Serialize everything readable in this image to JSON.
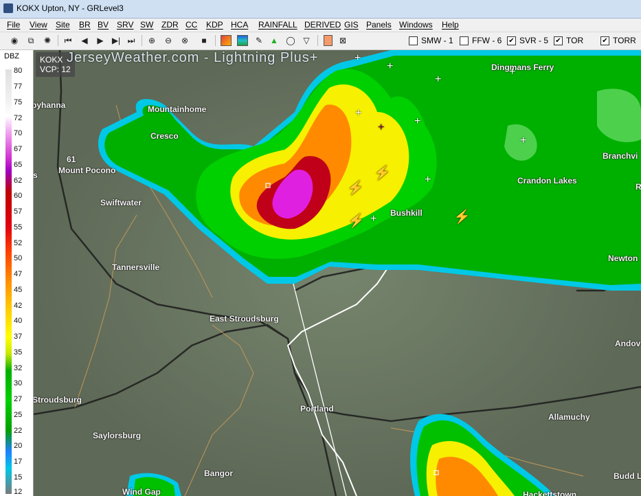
{
  "window": {
    "title": "KOKX Upton, NY - GRLevel3"
  },
  "menu": [
    "File",
    "View",
    "Site",
    "BR",
    "BV",
    "SRV",
    "SW",
    "ZDR",
    "CC",
    "KDP",
    "HCA",
    "RAINFALL",
    "DERIVED",
    "GIS",
    "Panels",
    "Windows",
    "Help"
  ],
  "warnings": [
    {
      "label": "SMW - 1",
      "checked": false
    },
    {
      "label": "FFW - 6",
      "checked": false
    },
    {
      "label": "SVR - 5",
      "checked": true
    },
    {
      "label": "TOR",
      "checked": true
    },
    {
      "label": "TORR",
      "checked": true
    }
  ],
  "colorbar": {
    "header": "DBZ",
    "labels": [
      "80",
      "77",
      "75",
      "72",
      "70",
      "67",
      "65",
      "62",
      "60",
      "57",
      "55",
      "52",
      "50",
      "47",
      "45",
      "42",
      "40",
      "37",
      "35",
      "32",
      "30",
      "27",
      "25",
      "22",
      "20",
      "17",
      "15",
      "12"
    ]
  },
  "radar": {
    "site": "KOKX",
    "vcp": "VCP: 12",
    "overlay_title": "JerseyWeather.com - Lightning Plus+"
  },
  "cities": [
    "Dingmans Ferry",
    "Mountainhome",
    "Cresco",
    "Mount Pocono",
    "Swiftwater",
    "Crandon Lakes",
    "Branchvi",
    "Bushkill",
    "Tannersville",
    "Newton",
    "East Stroudsburg",
    "Andov",
    "Stroudsburg",
    "Portland",
    "Allamuchy",
    "Saylorsburg",
    "Bangor",
    "Budd L",
    "Wind Gap",
    "Hackettstown",
    "byhanna",
    "61",
    "s",
    "R"
  ],
  "colors": {
    "magenta": "#e020e0",
    "red": "#c00018",
    "orange": "#ff8a00",
    "yellow": "#f7f000",
    "green": "#00c000",
    "lightgreen": "#6ee06e",
    "cyan": "#00c8e6"
  }
}
